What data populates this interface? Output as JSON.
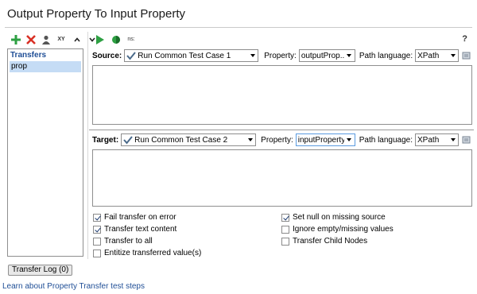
{
  "title": "Output Property To Input Property",
  "left_panel": {
    "header": "Transfers",
    "items": [
      "prop"
    ]
  },
  "toolbar": {
    "left_icons": [
      "add-icon",
      "delete-icon",
      "user-icon",
      "xy-icon",
      "move-up-icon",
      "move-down-icon"
    ],
    "xy_label": "XY",
    "right_icons": [
      "run-icon",
      "run-all-icon",
      "ns-icon"
    ],
    "ns_label": "ns:",
    "help_label": "?"
  },
  "source": {
    "label": "Source:",
    "step_value": "Run Common Test Case 1",
    "property_label": "Property:",
    "property_value": "outputProp...",
    "path_language_label": "Path language:",
    "path_language_value": "XPath"
  },
  "target": {
    "label": "Target:",
    "step_value": "Run Common Test Case 2",
    "property_label": "Property:",
    "property_value": "inputProperty",
    "path_language_label": "Path language:",
    "path_language_value": "XPath"
  },
  "options": {
    "left": [
      {
        "label": "Fail transfer on error",
        "checked": true
      },
      {
        "label": "Transfer text content",
        "checked": true
      },
      {
        "label": "Transfer to all",
        "checked": false
      },
      {
        "label": "Entitize transferred value(s)",
        "checked": false
      }
    ],
    "right": [
      {
        "label": "Set null on missing source",
        "checked": true
      },
      {
        "label": "Ignore empty/missing values",
        "checked": false
      },
      {
        "label": "Transfer Child Nodes",
        "checked": false
      }
    ]
  },
  "transfer_log_tab": "Transfer Log (0)",
  "learn_link": "Learn about Property Transfer test steps",
  "colors": {
    "accent": "#1f4e96",
    "selection": "#c5dcf5"
  }
}
